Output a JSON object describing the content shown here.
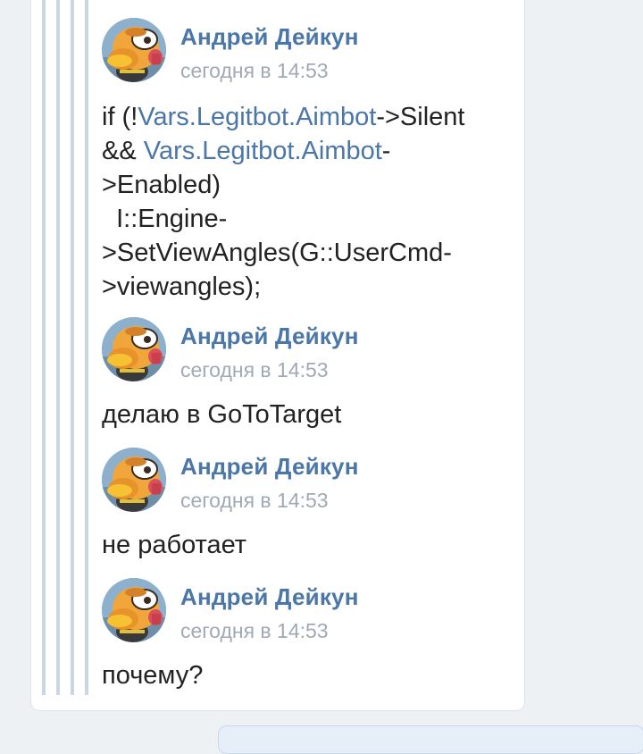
{
  "messages": [
    {
      "author": "Андрей Дейкун",
      "time": "сегодня в 14:53",
      "body": [
        {
          "text": "if (!",
          "link": false
        },
        {
          "text": "Vars.Legitbot.Aimbot",
          "link": true
        },
        {
          "text": "->Silent\n&& ",
          "link": false
        },
        {
          "text": "Vars.Legitbot.Aimbot",
          "link": true
        },
        {
          "text": "-\n>Enabled)\n  I::Engine-\n>SetViewAngles(G::UserCmd-\n>viewangles);",
          "link": false
        }
      ]
    },
    {
      "author": "Андрей Дейкун",
      "time": "сегодня в 14:53",
      "body": [
        {
          "text": "делаю в GoToTarget",
          "link": false
        }
      ]
    },
    {
      "author": "Андрей Дейкун",
      "time": "сегодня в 14:53",
      "body": [
        {
          "text": "не работает",
          "link": false
        }
      ]
    },
    {
      "author": "Андрей Дейкун",
      "time": "сегодня в 14:53",
      "body": [
        {
          "text": "почему?",
          "link": false
        }
      ]
    }
  ],
  "colors": {
    "author": "#4a76a8",
    "link": "#4a76a8",
    "time": "#a0a9b5",
    "quote_bar": "#c9d7e5",
    "background": "#eef1f4"
  },
  "icons": {
    "avatar": "cartoon-bird-avatar"
  }
}
